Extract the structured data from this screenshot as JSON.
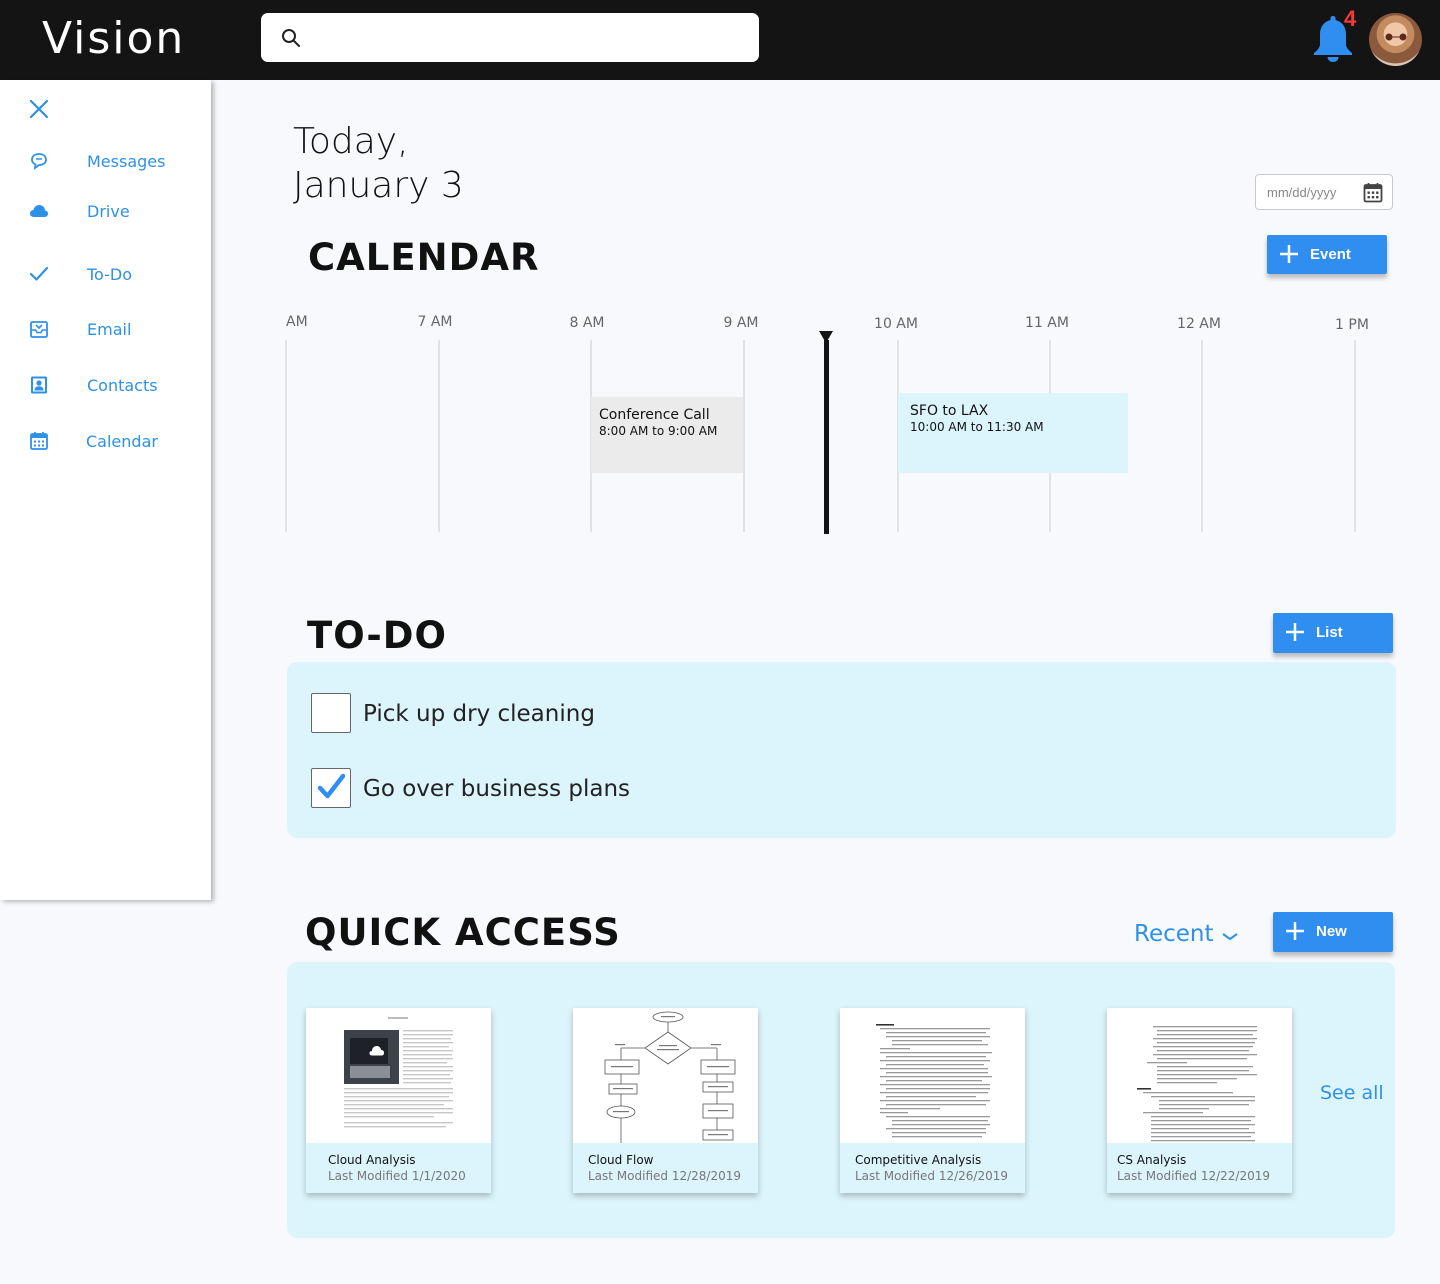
{
  "app": {
    "logo": "Vision"
  },
  "search": {
    "placeholder": "",
    "value": ""
  },
  "notifications": {
    "count": "4",
    "icon": "bell-icon",
    "color": "#2f8ef0",
    "badge_color": "#f23a3a"
  },
  "sidebar": {
    "close_icon": "close-icon",
    "items": [
      {
        "label": "Messages",
        "icon": "chat-bubbles-icon"
      },
      {
        "label": "Drive",
        "icon": "cloud-icon"
      },
      {
        "label": "To-Do",
        "icon": "checkmark-icon"
      },
      {
        "label": "Email",
        "icon": "inbox-icon"
      },
      {
        "label": "Contacts",
        "icon": "contact-card-icon"
      },
      {
        "label": "Calendar",
        "icon": "calendar-icon"
      }
    ]
  },
  "header": {
    "today_line1": "Today,",
    "today_line2": "January 3",
    "date_placeholder": "mm/dd/yyyy"
  },
  "calendar": {
    "title": "CALENDAR",
    "add_button": "Event",
    "hours": [
      "AM",
      "7 AM",
      "8 AM",
      "9 AM",
      "10 AM",
      "11 AM",
      "12 AM",
      "1 PM"
    ],
    "events": [
      {
        "title": "Conference Call",
        "time": "8:00 AM to 9:00 AM",
        "color": "#ebebeb"
      },
      {
        "title": "SFO to LAX",
        "time": "10:00 AM to 11:30 AM",
        "color": "#dcf5fc"
      }
    ]
  },
  "todo": {
    "title": "TO-DO",
    "add_button": "List",
    "items": [
      {
        "text": "Pick up dry cleaning",
        "checked": false
      },
      {
        "text": "Go over business plans",
        "checked": true
      }
    ]
  },
  "quick_access": {
    "title": "QUICK ACCESS",
    "sort_label": "Recent",
    "add_button": "New",
    "see_all": "See all",
    "files": [
      {
        "name": "Cloud Analysis",
        "modified": "Last Modified 1/1/2020"
      },
      {
        "name": "Cloud Flow",
        "modified": "Last Modified 12/28/2019"
      },
      {
        "name": "Competitive Analysis",
        "modified": "Last Modified 12/26/2019"
      },
      {
        "name": "CS Analysis",
        "modified": "Last Modified 12/22/2019"
      }
    ]
  },
  "colors": {
    "accent": "#2f8ef0",
    "panel": "#dcf5fc",
    "topbar": "#141414"
  }
}
